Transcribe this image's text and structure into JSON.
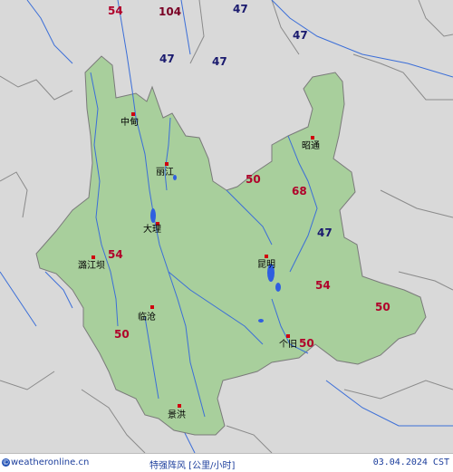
{
  "map": {
    "land_color": "#dadada",
    "province_color": "#a8cf9c",
    "border_color": "#888888",
    "river_color": "#3b6ed8",
    "lake_color": "#2f5fe0"
  },
  "cities": [
    {
      "name": "中甸",
      "icon": "city-marker"
    },
    {
      "name": "丽江",
      "icon": "city-marker"
    },
    {
      "name": "昭通",
      "icon": "city-marker"
    },
    {
      "name": "大理",
      "icon": "city-marker"
    },
    {
      "name": "潞江坝",
      "icon": "city-marker"
    },
    {
      "name": "昆明",
      "icon": "city-marker"
    },
    {
      "name": "临沧",
      "icon": "city-marker"
    },
    {
      "name": "个旧",
      "icon": "city-marker"
    },
    {
      "name": "景洪",
      "icon": "city-marker"
    }
  ],
  "wind_values": [
    {
      "value": "54",
      "color": "#b0002a"
    },
    {
      "value": "104",
      "color": "#7a0024"
    },
    {
      "value": "47",
      "color": "#1a1a6e"
    },
    {
      "value": "47",
      "color": "#1a1a6e"
    },
    {
      "value": "47",
      "color": "#1a1a6e"
    },
    {
      "value": "47",
      "color": "#1a1a6e"
    },
    {
      "value": "50",
      "color": "#b0002a"
    },
    {
      "value": "68",
      "color": "#b0002a"
    },
    {
      "value": "47",
      "color": "#1a1a6e"
    },
    {
      "value": "54",
      "color": "#b0002a"
    },
    {
      "value": "54",
      "color": "#b0002a"
    },
    {
      "value": "50",
      "color": "#b0002a"
    },
    {
      "value": "50",
      "color": "#b0002a"
    },
    {
      "value": "50",
      "color": "#b0002a"
    }
  ],
  "footer": {
    "source": "weatheronline.cn",
    "copyright_icon": "©",
    "title": "特强阵风   [公里/小时]",
    "date": "03.04.2024 CST"
  }
}
